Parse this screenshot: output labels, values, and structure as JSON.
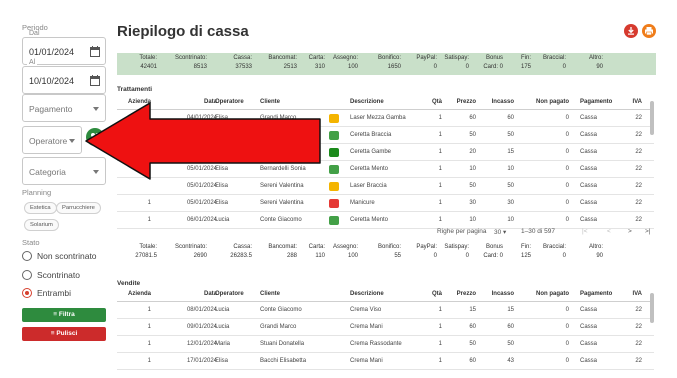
{
  "sidebar": {
    "periodo_label": "Periodo",
    "dal_label": "Dal",
    "dal_value": "01/01/2024",
    "al_label": "Al",
    "al_value": "10/10/2024",
    "pagamento_placeholder": "Pagamento",
    "operatore_placeholder": "Operatore",
    "categoria_placeholder": "Categoria",
    "planning_label": "Planning",
    "chips": [
      "Estetica",
      "Parrucchiere",
      "Solarium"
    ],
    "stato_label": "Stato",
    "radios": [
      {
        "label": "Non scontrinato",
        "selected": false
      },
      {
        "label": "Scontrinato",
        "selected": false
      },
      {
        "label": "Entrambi",
        "selected": true
      }
    ],
    "filtra_label": "Filtra",
    "pulisci_label": "Pulisci"
  },
  "header": {
    "title": "Riepilogo di cassa",
    "download_icon": "download-icon",
    "print_icon": "print-icon",
    "download_color": "#d63a2e",
    "print_color": "#ef7d1a"
  },
  "summary_top": {
    "cells": [
      {
        "label": "Totale:",
        "value": "42401"
      },
      {
        "label": "Scontrinato:",
        "value": "8513"
      },
      {
        "label": "Cassa:",
        "value": "37533"
      },
      {
        "label": "Bancomat:",
        "value": "2513"
      },
      {
        "label": "Carta:",
        "value": "310"
      },
      {
        "label": "Assegno:",
        "value": "100"
      },
      {
        "label": "Bonifico:",
        "value": "1650"
      },
      {
        "label": "PayPal:",
        "value": "0"
      },
      {
        "label": "Satispay:",
        "value": "0"
      },
      {
        "label": "Bonus",
        "value": "Card: 0"
      },
      {
        "label": "Fin:",
        "value": "175"
      },
      {
        "label": "Braccial:",
        "value": "0"
      },
      {
        "label": "Altro:",
        "value": "90"
      }
    ]
  },
  "trattamenti": {
    "title": "Trattamenti",
    "headers": [
      "Azienda",
      "Data",
      "Operatore",
      "Cliente",
      "Descrizione",
      "Qtà",
      "Prezzo",
      "Incasso",
      "Non pagato",
      "Pagamento",
      "IVA"
    ],
    "rows": [
      {
        "azienda": "",
        "data": "04/01/2024",
        "operatore": "Elisa",
        "cliente": "Grandi Marco",
        "color": "#f4b400",
        "descrizione": "Laser Mezza Gamba",
        "qta": "1",
        "prezzo": "60",
        "incasso": "60",
        "non_pagato": "0",
        "pagamento": "Cassa",
        "iva": "22"
      },
      {
        "azienda": "",
        "data": "",
        "operatore": "",
        "cliente": "",
        "color": "#43a047",
        "descrizione": "Ceretta Braccia",
        "qta": "1",
        "prezzo": "50",
        "incasso": "50",
        "non_pagato": "0",
        "pagamento": "Cassa",
        "iva": "22"
      },
      {
        "azienda": "",
        "data": "",
        "operatore": "",
        "cliente": "",
        "color": "#1b8a1b",
        "descrizione": "Ceretta Gambe",
        "qta": "1",
        "prezzo": "20",
        "incasso": "15",
        "non_pagato": "0",
        "pagamento": "Cassa",
        "iva": "22"
      },
      {
        "azienda": "",
        "data": "05/01/2024",
        "operatore": "Elisa",
        "cliente": "Bernardelli Sonia",
        "color": "#43a047",
        "descrizione": "Ceretta Mento",
        "qta": "1",
        "prezzo": "10",
        "incasso": "10",
        "non_pagato": "0",
        "pagamento": "Cassa",
        "iva": "22"
      },
      {
        "azienda": "",
        "data": "05/01/2024",
        "operatore": "Elisa",
        "cliente": "Sereni Valentina",
        "color": "#f4b400",
        "descrizione": "Laser Braccia",
        "qta": "1",
        "prezzo": "50",
        "incasso": "50",
        "non_pagato": "0",
        "pagamento": "Cassa",
        "iva": "22"
      },
      {
        "azienda": "1",
        "data": "05/01/2024",
        "operatore": "Elisa",
        "cliente": "Sereni Valentina",
        "color": "#e53935",
        "descrizione": "Manicure",
        "qta": "1",
        "prezzo": "30",
        "incasso": "30",
        "non_pagato": "0",
        "pagamento": "Cassa",
        "iva": "22"
      },
      {
        "azienda": "1",
        "data": "06/01/2024",
        "operatore": "Lucia",
        "cliente": "Conte Giacomo",
        "color": "#43a047",
        "descrizione": "Ceretta Mento",
        "qta": "1",
        "prezzo": "10",
        "incasso": "10",
        "non_pagato": "0",
        "pagamento": "Cassa",
        "iva": "22"
      }
    ],
    "pagination": {
      "rows_label": "Righe per pagina",
      "rows_value": "30",
      "range": "1–30 di 597"
    }
  },
  "summary_mid": {
    "cells": [
      {
        "label": "Totale:",
        "value": "27081.5"
      },
      {
        "label": "Scontrinato:",
        "value": "2690"
      },
      {
        "label": "Cassa:",
        "value": "26283.5"
      },
      {
        "label": "Bancomat:",
        "value": "288"
      },
      {
        "label": "Carta:",
        "value": "110"
      },
      {
        "label": "Assegno:",
        "value": "100"
      },
      {
        "label": "Bonifico:",
        "value": "55"
      },
      {
        "label": "PayPal:",
        "value": "0"
      },
      {
        "label": "Satispay:",
        "value": "0"
      },
      {
        "label": "Bonus",
        "value": "Card: 0"
      },
      {
        "label": "Fin:",
        "value": "125"
      },
      {
        "label": "Braccial:",
        "value": "0"
      },
      {
        "label": "Altro:",
        "value": "90"
      }
    ]
  },
  "vendite": {
    "title": "Vendite",
    "headers": [
      "Azienda",
      "Data",
      "Operatore",
      "Cliente",
      "Descrizione",
      "Qtà",
      "Prezzo",
      "Incasso",
      "Non pagato",
      "Pagamento",
      "IVA"
    ],
    "rows": [
      {
        "azienda": "1",
        "data": "08/01/2024",
        "operatore": "Lucia",
        "cliente": "Conte Giacomo",
        "descrizione": "Crema Viso",
        "qta": "1",
        "prezzo": "15",
        "incasso": "15",
        "non_pagato": "0",
        "pagamento": "Cassa",
        "iva": "22"
      },
      {
        "azienda": "1",
        "data": "09/01/2024",
        "operatore": "Lucia",
        "cliente": "Grandi Marco",
        "descrizione": "Crema Mani",
        "qta": "1",
        "prezzo": "60",
        "incasso": "60",
        "non_pagato": "0",
        "pagamento": "Cassa",
        "iva": "22"
      },
      {
        "azienda": "1",
        "data": "12/01/2024",
        "operatore": "Maria",
        "cliente": "Stuani Donatella",
        "descrizione": "Crema Rassodante",
        "qta": "1",
        "prezzo": "50",
        "incasso": "50",
        "non_pagato": "0",
        "pagamento": "Cassa",
        "iva": "22"
      },
      {
        "azienda": "1",
        "data": "17/01/2024",
        "operatore": "Elisa",
        "cliente": "Bacchi Elisabetta",
        "descrizione": "Crema Mani",
        "qta": "1",
        "prezzo": "60",
        "incasso": "43",
        "non_pagato": "0",
        "pagamento": "Cassa",
        "iva": "22"
      }
    ]
  },
  "overlay": {
    "arrow_color": "#ee1111",
    "arrow_icon": "left-arrow-annotation"
  }
}
